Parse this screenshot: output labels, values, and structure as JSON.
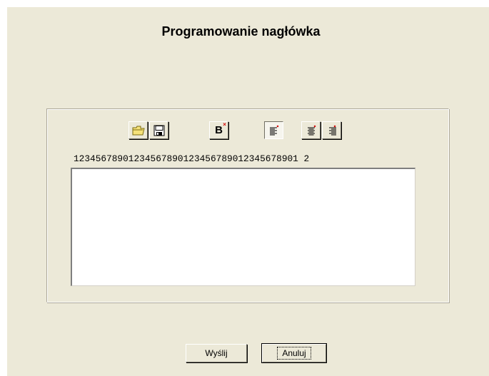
{
  "dialog": {
    "title": "Programowanie nagłówka"
  },
  "toolbar": {
    "buttons": [
      {
        "icon": "open-folder-icon",
        "pressed": false
      },
      {
        "icon": "save-floppy-icon",
        "pressed": false
      },
      {
        "icon": "bold-icon",
        "label": "B",
        "pressed": false
      },
      {
        "icon": "align-left-icon",
        "pressed": true
      },
      {
        "icon": "align-center-icon",
        "pressed": false
      },
      {
        "icon": "align-right-icon",
        "pressed": false
      }
    ]
  },
  "ruler": {
    "text": "12345678901234567890123456789012345678901 2"
  },
  "editor": {
    "value": ""
  },
  "actions": {
    "send_label": "Wyślij",
    "cancel_label": "Anuluj"
  },
  "colors": {
    "dialog_bg": "#ece9d8",
    "folder_yellow": "#f5e27a",
    "accent_red": "#d40000"
  }
}
